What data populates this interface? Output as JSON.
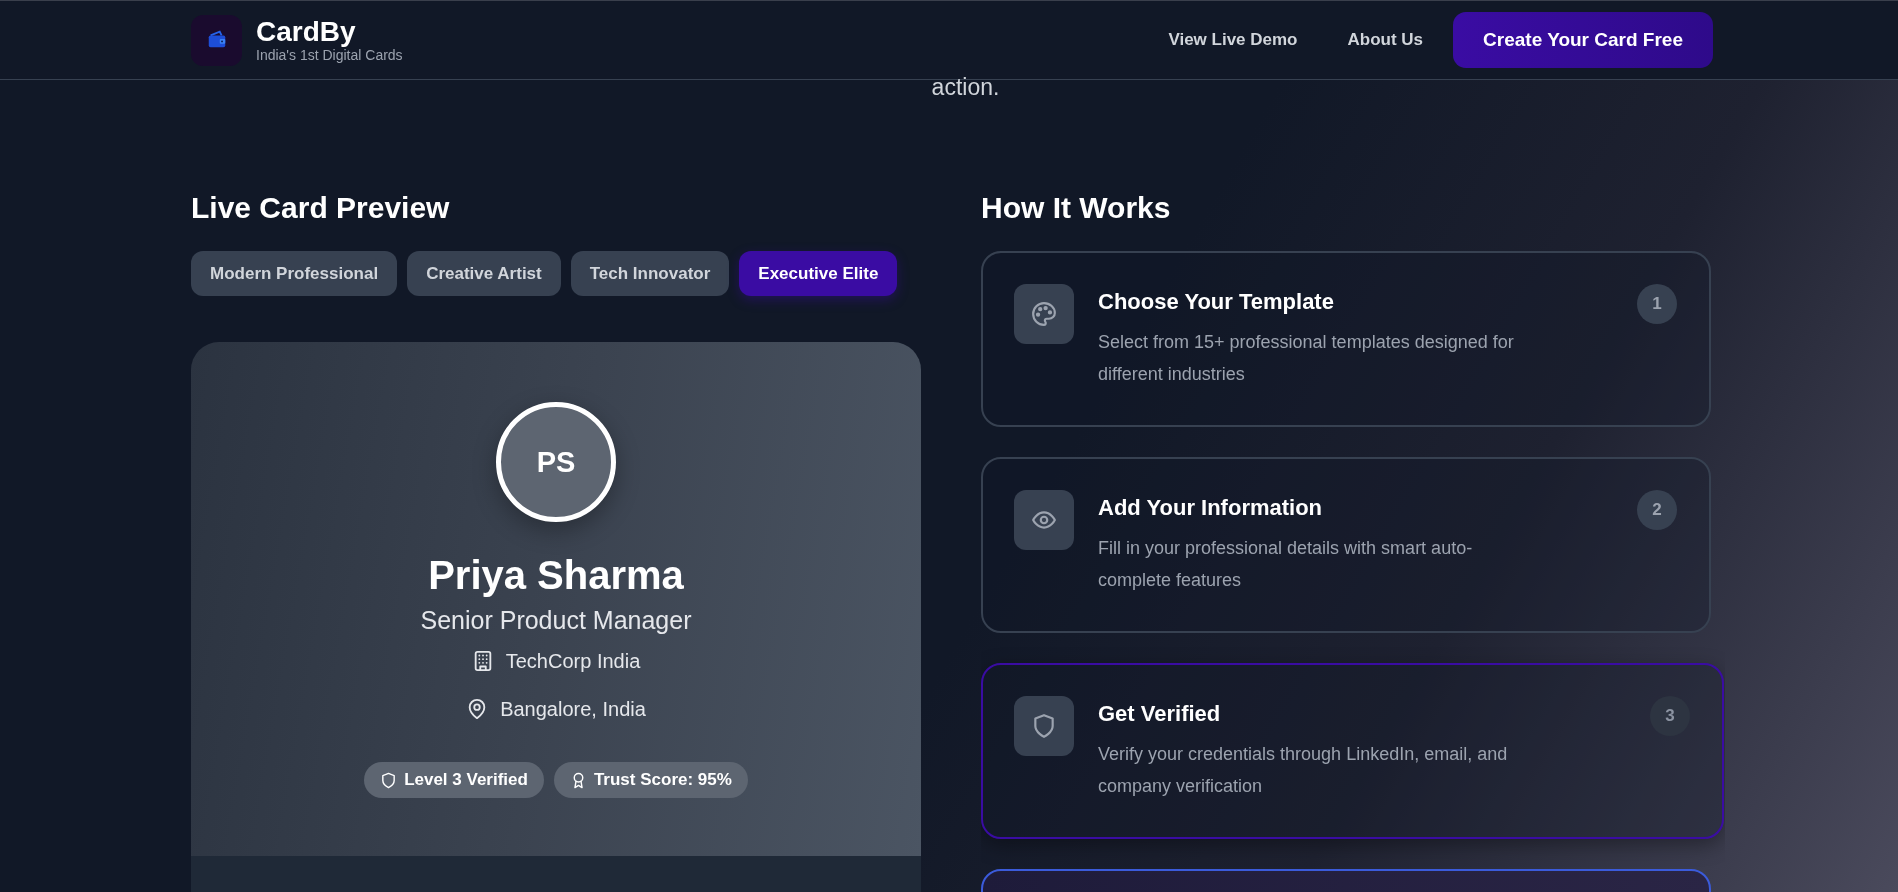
{
  "header": {
    "brand": "CardBy",
    "tagline": "India's 1st Digital Cards",
    "nav": [
      "View Live Demo",
      "About Us"
    ],
    "cta": "Create Your Card Free"
  },
  "intro_tail": "action.",
  "preview": {
    "title": "Live Card Preview",
    "tabs": [
      {
        "label": "Modern Professional",
        "selected": false
      },
      {
        "label": "Creative Artist",
        "selected": false
      },
      {
        "label": "Tech Innovator",
        "selected": false
      },
      {
        "label": "Executive Elite",
        "selected": true
      }
    ],
    "card": {
      "initials": "PS",
      "name": "Priya Sharma",
      "role": "Senior Product Manager",
      "company": "TechCorp India",
      "location": "Bangalore, India",
      "badges": [
        {
          "kind": "verified",
          "label": "Level 3 Verified"
        },
        {
          "kind": "trust",
          "label": "Trust Score: 95%"
        }
      ]
    }
  },
  "how": {
    "title": "How It Works",
    "steps": [
      {
        "kind": "palette",
        "title": "Choose Your Template",
        "description": "Select from 15+ professional templates designed for different industries",
        "number": "1",
        "selected": false
      },
      {
        "kind": "eye",
        "title": "Add Your Information",
        "description": "Fill in your professional details with smart auto-complete features",
        "number": "2",
        "selected": false
      },
      {
        "kind": "shield",
        "title": "Get Verified",
        "description": "Verify your credentials through LinkedIn, email, and company verification",
        "number": "3",
        "selected": true
      },
      {
        "kind": "cutoff",
        "selected": false
      }
    ]
  }
}
